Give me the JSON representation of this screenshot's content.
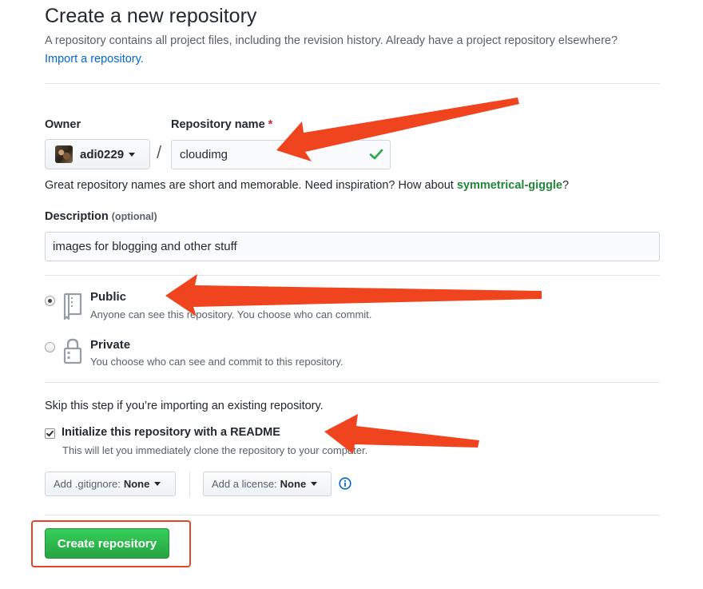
{
  "header": {
    "title": "Create a new repository",
    "intro_text": "A repository contains all project files, including the revision history. Already have a project repository elsewhere?",
    "import_link": "Import a repository."
  },
  "owner": {
    "label": "Owner",
    "value": "adi0229"
  },
  "repo_name": {
    "label": "Repository name",
    "required_mark": "*",
    "value": "cloudimg"
  },
  "name_hint": {
    "text": "Great repository names are short and memorable. Need inspiration? How about",
    "suggestion": "symmetrical-giggle",
    "suffix": "?"
  },
  "description": {
    "label": "Description",
    "optional": "(optional)",
    "value": "images for blogging and other stuff"
  },
  "visibility": {
    "public": {
      "title": "Public",
      "description": "Anyone can see this repository. You choose who can commit.",
      "selected": true,
      "icon": "repo-book-icon"
    },
    "private": {
      "title": "Private",
      "description": "You choose who can see and commit to this repository.",
      "selected": false,
      "icon": "lock-icon"
    }
  },
  "init": {
    "skip_text": "Skip this step if you’re importing an existing repository.",
    "readme_title": "Initialize this repository with a README",
    "readme_desc": "This will let you immediately clone the repository to your computer.",
    "readme_checked": true
  },
  "gitignore": {
    "prefix": "Add .gitignore:",
    "value": "None"
  },
  "license": {
    "prefix": "Add a license:",
    "value": "None"
  },
  "submit": {
    "label": "Create repository"
  },
  "colors": {
    "accent_link": "#0366d6",
    "success_green": "#28a745",
    "annotation_red": "#f0441e"
  }
}
